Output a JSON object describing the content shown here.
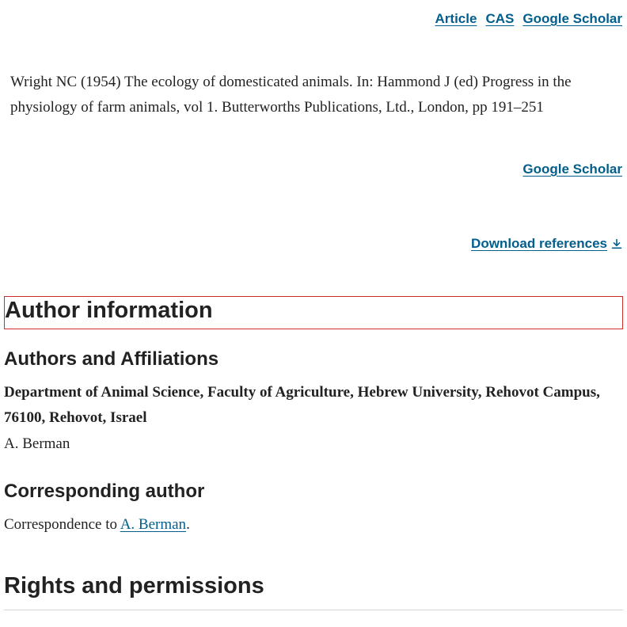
{
  "reference_links_top": {
    "article": "Article",
    "cas": "CAS",
    "google_scholar": "Google Scholar"
  },
  "reference": {
    "text": "Wright NC (1954) The ecology of domesticated animals. In: Hammond J (ed) Progress in the physiology of farm animals, vol 1. Butterworths Publications, Ltd., London, pp 191–251",
    "google_scholar": "Google Scholar"
  },
  "download_references": {
    "label": "Download references",
    "icon": "download-icon"
  },
  "author_information": {
    "heading": "Author information",
    "affiliations_heading": "Authors and Affiliations",
    "affiliation": "Department of Animal Science, Faculty of Agriculture, Hebrew University, Rehovot Campus, 76100, Rehovot, Israel",
    "author": "A. Berman",
    "corresponding_heading": "Corresponding author",
    "correspondence_prefix": "Correspondence to ",
    "correspondence_author": "A. Berman",
    "correspondence_suffix": "."
  },
  "rights": {
    "heading": "Rights and permissions"
  },
  "colors": {
    "link": "#025e8d",
    "text": "#222222",
    "highlight_border": "#d22b2b"
  }
}
